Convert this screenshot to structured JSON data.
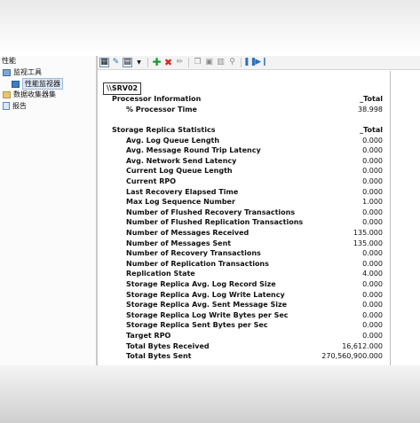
{
  "tree": {
    "root": "性能",
    "monitor_tools": "监视工具",
    "perf_monitor": "性能监视器",
    "collector_sets": "数据收集器集",
    "reports": "报告"
  },
  "toolbar": {
    "icons": [
      "view-graph-icon",
      "freeze-icon",
      "change-graph-type-icon",
      "add-counter-icon",
      "delete-counter-icon",
      "highlight-icon",
      "copy-properties-icon",
      "paste-counter-list-icon",
      "properties-icon",
      "zoom-icon",
      "pause-icon",
      "next-frame-icon"
    ]
  },
  "report": {
    "server": "\\\\SRV02",
    "sections": [
      {
        "title": "Processor Information",
        "instance": "_Total",
        "counters": [
          {
            "name": "% Processor Time",
            "value": "38.998"
          }
        ]
      },
      {
        "title": "Storage Replica Statistics",
        "instance": "_Total",
        "counters": [
          {
            "name": "Avg. Log Queue Length",
            "value": "0.000"
          },
          {
            "name": "Avg. Message Round Trip Latency",
            "value": "0.000"
          },
          {
            "name": "Avg. Network Send Latency",
            "value": "0.000"
          },
          {
            "name": "Current Log Queue Length",
            "value": "0.000"
          },
          {
            "name": "Current RPO",
            "value": "0.000"
          },
          {
            "name": "Last Recovery Elapsed Time",
            "value": "0.000"
          },
          {
            "name": "Max Log Sequence Number",
            "value": "1.000"
          },
          {
            "name": "Number of Flushed Recovery Transactions",
            "value": "0.000"
          },
          {
            "name": "Number of Flushed Replication Transactions",
            "value": "0.000"
          },
          {
            "name": "Number of Messages Received",
            "value": "135.000"
          },
          {
            "name": "Number of Messages Sent",
            "value": "135.000"
          },
          {
            "name": "Number of Recovery Transactions",
            "value": "0.000"
          },
          {
            "name": "Number of Replication Transactions",
            "value": "0.000"
          },
          {
            "name": "Replication State",
            "value": "4.000"
          },
          {
            "name": "Storage Replica Avg. Log Record Size",
            "value": "0.000"
          },
          {
            "name": "Storage Replica Avg. Log Write Latency",
            "value": "0.000"
          },
          {
            "name": "Storage Replica Avg. Sent Message Size",
            "value": "0.000"
          },
          {
            "name": "Storage Replica Log Write Bytes per Sec",
            "value": "0.000"
          },
          {
            "name": "Storage Replica Sent Bytes per Sec",
            "value": "0.000"
          },
          {
            "name": "Target RPO",
            "value": "0.000"
          },
          {
            "name": "Total Bytes Received",
            "value": "16,612.000"
          },
          {
            "name": "Total Bytes Sent",
            "value": "270,560,900.000"
          }
        ]
      }
    ]
  }
}
